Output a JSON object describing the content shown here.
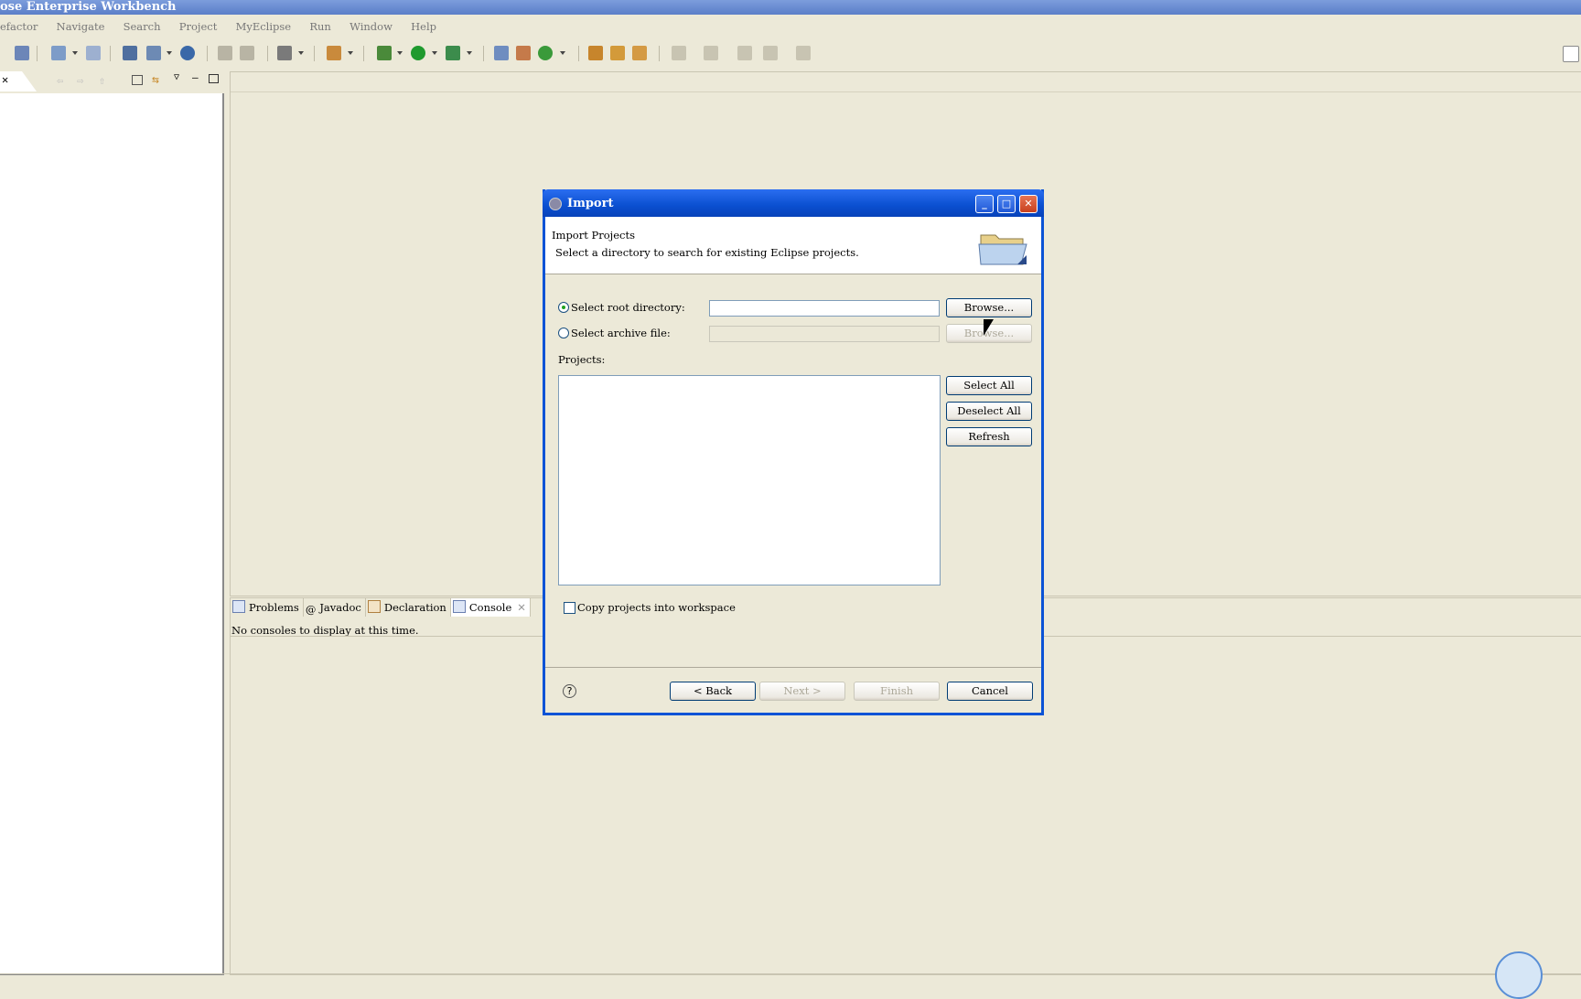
{
  "window": {
    "title": "ose Enterprise Workbench"
  },
  "menu": [
    "efactor",
    "Navigate",
    "Search",
    "Project",
    "MyEclipse",
    "Run",
    "Window",
    "Help"
  ],
  "bottom_tabs": [
    {
      "label": "Problems",
      "icon": "problems-icon"
    },
    {
      "label": "Javadoc",
      "icon": "javadoc-icon"
    },
    {
      "label": "Declaration",
      "icon": "declaration-icon"
    },
    {
      "label": "Console",
      "icon": "console-icon"
    }
  ],
  "console": {
    "message": "No consoles to display at this time."
  },
  "dialog": {
    "title": "Import",
    "header_title": "Import Projects",
    "header_desc": "Select a directory to search for existing Eclipse projects.",
    "root_dir_label": "Select root directory:",
    "root_dir_value": "",
    "archive_label": "Select archive file:",
    "archive_value": "",
    "browse_label": "Browse...",
    "browse_disabled_label": "Browse...",
    "projects_label": "Projects:",
    "select_all": "Select All",
    "deselect_all": "Deselect All",
    "refresh": "Refresh",
    "copy_label": "Copy projects into workspace",
    "back": "< Back",
    "next": "Next >",
    "finish": "Finish",
    "cancel": "Cancel",
    "help_glyph": "?",
    "selected_option": "root_directory"
  }
}
